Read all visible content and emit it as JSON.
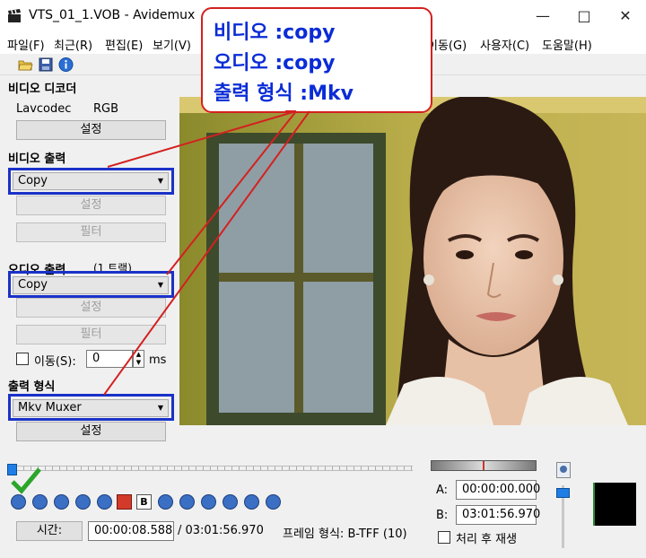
{
  "window": {
    "title": "VTS_01_1.VOB - Avidemux"
  },
  "menu": {
    "items": [
      "파일(F)",
      "최근(R)",
      "편집(E)",
      "보기(V)",
      "이동(G)",
      "사용자(C)",
      "도움말(H)"
    ]
  },
  "toolbar": {
    "icons": [
      "open-icon",
      "save-icon",
      "info-icon"
    ]
  },
  "video_decoder": {
    "label": "비디오 디코더",
    "codec": "Lavcodec",
    "format": "RGB",
    "settings": "설정"
  },
  "video_output": {
    "label": "비디오 출력",
    "selected": "Copy",
    "settings": "설정",
    "filter": "필터"
  },
  "audio_output": {
    "label": "오디오 출력",
    "tracks": "(1 트랙)",
    "selected": "Copy",
    "settings": "설정",
    "filter": "필터",
    "shift_label": "이동(S):",
    "shift_value": "0",
    "shift_unit": "ms"
  },
  "output_format": {
    "label": "출력 형식",
    "selected": "Mkv Muxer",
    "settings": "설정"
  },
  "callout": {
    "line1": "비디오 :copy",
    "line2": "오디오 :copy",
    "line3": "출력 형식 :Mkv"
  },
  "status": {
    "time_label": "시간:",
    "current_time": "00:00:08.588",
    "total_time": "/ 03:01:56.970",
    "frame_type": "프레임 형식: B-TFF (10)",
    "a_label": "A:",
    "a_time": "00:00:00.000",
    "b_label": "B:",
    "b_time": "03:01:56.970",
    "play_after": "처리 후 재생"
  },
  "colors": {
    "callout_border": "#d42020",
    "callout_text": "#0a2cd6",
    "highlight_box": "#1a32c8"
  }
}
